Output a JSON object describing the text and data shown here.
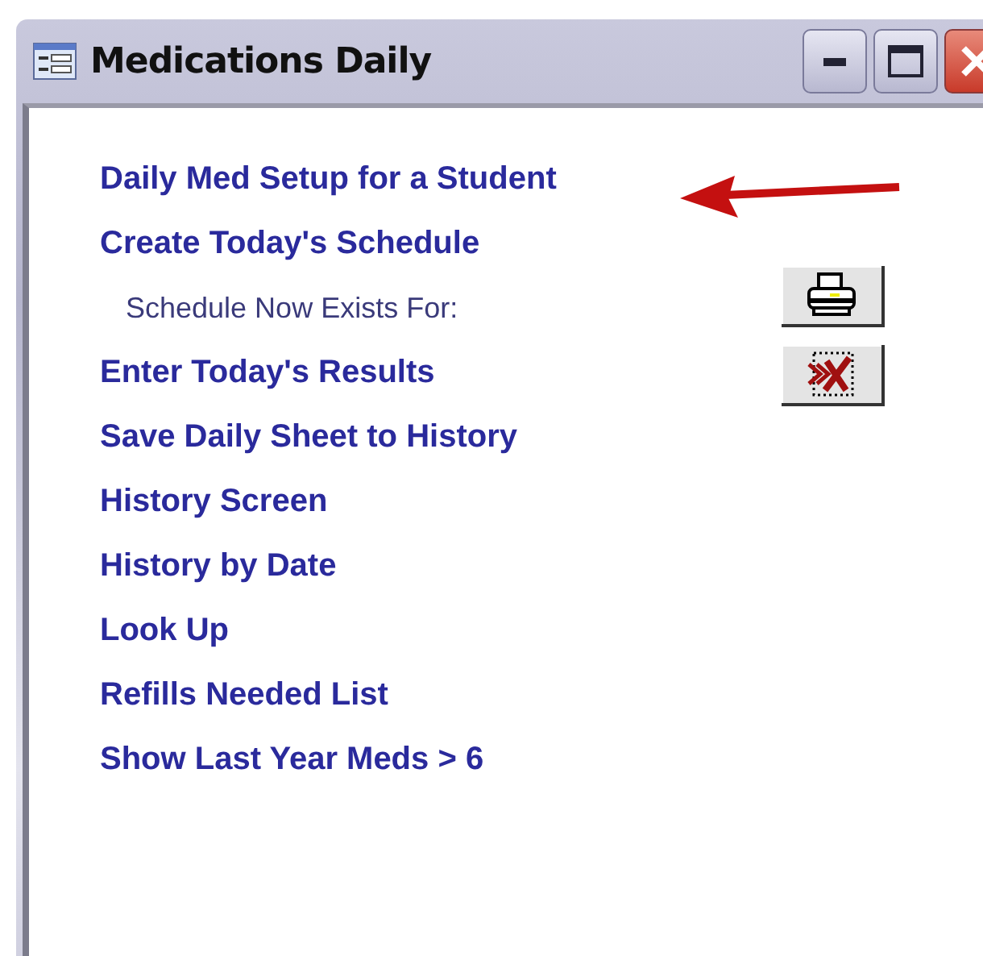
{
  "window": {
    "title": "Medications Daily"
  },
  "items": [
    {
      "kind": "link",
      "label": "Daily Med Setup for a Student"
    },
    {
      "kind": "link",
      "label": "Create Today's Schedule"
    },
    {
      "kind": "note",
      "label": "Schedule Now Exists For:"
    },
    {
      "kind": "link",
      "label": "Enter Today's Results"
    },
    {
      "kind": "link",
      "label": "Save Daily Sheet to History"
    },
    {
      "kind": "link",
      "label": "History Screen"
    },
    {
      "kind": "link",
      "label": "History by Date"
    },
    {
      "kind": "link",
      "label": "Look Up"
    },
    {
      "kind": "link",
      "label": "Refills Needed List"
    },
    {
      "kind": "link",
      "label": "Show Last Year Meds > 6"
    }
  ],
  "side_buttons": [
    {
      "kind": "print"
    },
    {
      "kind": "cancel"
    }
  ]
}
